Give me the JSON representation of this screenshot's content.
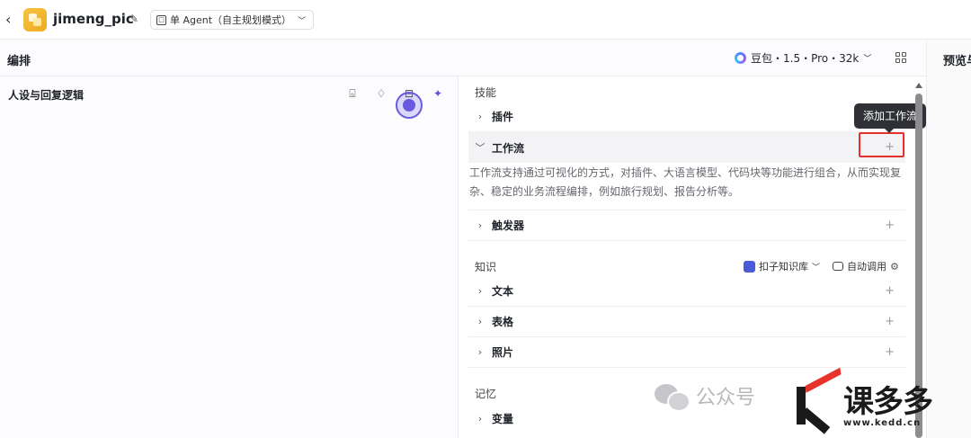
{
  "header": {
    "app_title": "jimeng_pic",
    "agent_mode": "单 Agent（自主规划模式）"
  },
  "arrange": {
    "title": "编排",
    "model": "豆包・1.5・Pro・32k",
    "preview_label": "预览与"
  },
  "persona": {
    "title": "人设与回复逻辑"
  },
  "skills": {
    "group_label": "技能",
    "items": [
      {
        "label": "插件",
        "expanded": false
      },
      {
        "label": "工作流",
        "expanded": true
      },
      {
        "label": "触发器",
        "expanded": false
      }
    ],
    "workflow_description": "工作流支持通过可视化的方式，对插件、大语言模型、代码块等功能进行组合，从而实现复杂、稳定的业务流程编排，例如旅行规划、报告分析等。",
    "add_workflow_tooltip": "添加工作流"
  },
  "knowledge": {
    "group_label": "知识",
    "kb_select": "扣子知识库",
    "auto_call": "自动调用",
    "items": [
      {
        "label": "文本"
      },
      {
        "label": "表格"
      },
      {
        "label": "照片"
      }
    ]
  },
  "memory": {
    "group_label": "记忆",
    "items": [
      {
        "label": "变量"
      }
    ]
  },
  "watermark": {
    "wechat_text": "公众号",
    "brand_cn": "课多多",
    "brand_url": "www.kedd.cn"
  }
}
